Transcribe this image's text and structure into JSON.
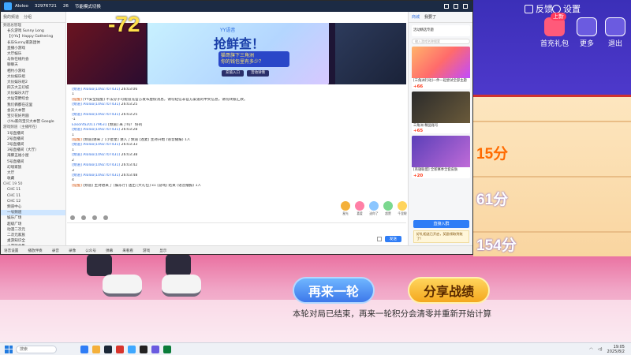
{
  "game": {
    "top_buttons": {
      "feedback": "反馈",
      "settings": "设置"
    },
    "side_buttons": {
      "recharge": "首充礼包",
      "recharge_badge": "上新",
      "more": "更多",
      "exit": "退出"
    },
    "scores": [
      "15分",
      "61分",
      "154分"
    ],
    "overlay_delta": "-72",
    "again_label": "再来一轮",
    "share_label": "分享战绩",
    "end_note": "本轮对局已结束，再来一轮积分会清零并重新开始计算"
  },
  "yy_window": {
    "title_name": "Aloloo",
    "title_id": "32976721",
    "title_count": "26",
    "title_link": "节能模式切换",
    "left_header": [
      "我的频道",
      "分组"
    ],
    "channel_tree": [
      "频道总管理",
      "长久游戏 Sunny Long",
      "【小Yu】Happy Gathering",
      "长乐Sunny家族团体",
      "直播小游戏",
      "大厅娱乐",
      "与你在线约会",
      "聊聊天",
      "相约小游戏",
      "大伙娱乐组",
      "大伙娱乐组2",
      "四方大王幻城",
      "大伙娱乐大厅",
      "大仙雪野综合",
      "我们俩都在这里",
      "会员大本营",
      "宝贝花好月圆",
      "小Yu家的宝贝大本营 Google",
      "游戏频道（主播所在）",
      "1号直播间",
      "2号直播间",
      "3号直播间",
      "3号直播间（大厅）",
      "海豚五福小屋",
      "5号直播间",
      "幻境家族",
      "大厅",
      "收藏",
      "CHC 19 50",
      "CHC 11",
      "CHC 11",
      "CHC 12",
      "频道中心",
      "一号频道",
      "娱乐广场",
      "超级广场",
      "动漫二次元",
      "二次元家族",
      "桌游知识全",
      "小游戏合集",
      "休闲广场",
      "网络游戏",
      "社交娱乐",
      "更多频道"
    ],
    "banner": {
      "brand": "YY语音",
      "headline": "抢鲜查！",
      "sub_line1": "猫哥旗下三角洲",
      "sub_line2": "你的钱包里有多少？",
      "btn1": "充值入口",
      "btn2": "活动详情"
    },
    "messages": [
      {
        "name": "[频道] Aloloo(1092707431)",
        "text": "26:03:06"
      },
      {
        "name": "",
        "text": "1"
      },
      {
        "name": "[提醒]",
        "text": "[YY安全提醒] 不法分子可能冒充官方发布虚假消息，请勿轻信非官方渠道的中奖信息，请勿转账汇款。"
      },
      {
        "name": "[频道] Aloloo(1092707431)",
        "text": "26:03:25"
      },
      {
        "name": "",
        "text": "1"
      },
      {
        "name": "[频道] Aloloo(1092707431)",
        "text": "26:03:25"
      },
      {
        "name": "",
        "text": "-1"
      },
      {
        "name": "Easonfa201179631",
        "text": "[频道] 来了吗？ 好的"
      },
      {
        "name": "[频道] Aloloo(1092707431)",
        "text": "26:03:28"
      },
      {
        "name": "",
        "text": "1"
      },
      {
        "name": "[提醒]",
        "text": "[频道]进来了 [小星星] 进入了频道 [连麦] 主持开始 (语音播报) 1人"
      },
      {
        "name": "[频道] Aloloo(1092707431)",
        "text": "26:03:33"
      },
      {
        "name": "",
        "text": "1"
      },
      {
        "name": "[频道] Aloloo(1092707431)",
        "text": "26:03:38"
      },
      {
        "name": "",
        "text": "2"
      },
      {
        "name": "[频道] Aloloo(1092707431)",
        "text": "26:03:42"
      },
      {
        "name": "",
        "text": "3"
      },
      {
        "name": "[频道] Aloloo(1092707431)",
        "text": "26:03:48"
      },
      {
        "name": "",
        "text": "4"
      },
      {
        "name": "[提醒]",
        "text": "[频道] 主持进来了 [娱乐厅] 送出 [大礼包] x1 [游戏] 结束 (语音播报) 1人"
      }
    ],
    "gifts": [
      "星光",
      "喜爱",
      "送你了",
      "超赞",
      "千里眼"
    ],
    "send_label": "发送",
    "right": {
      "tabs": [
        "商城",
        "我要了"
      ],
      "promo_title": "活动精选专题",
      "search_placeholder": "输入游戏名称搜索",
      "cards": [
        {
          "title": "[三角洲行动]一件一起尝试全部主题",
          "price": "+66"
        },
        {
          "title": "三角洲 精品账号",
          "price": "+65"
        },
        {
          "title": "[英雄联盟] 全新赛季全套皮肤",
          "price": "+20"
        }
      ],
      "buy_label": "直接入群",
      "toast": "好礼相送已开启，奖励领取到账了!"
    },
    "statusbar": [
      "语音设置",
      "播放伴奏",
      "录音",
      "录像",
      "公众号",
      "弹幕",
      "来看看",
      "游戏",
      "显示"
    ]
  },
  "taskbar": {
    "search": "搜索",
    "time": "19:05",
    "date": "2025/8/2"
  }
}
